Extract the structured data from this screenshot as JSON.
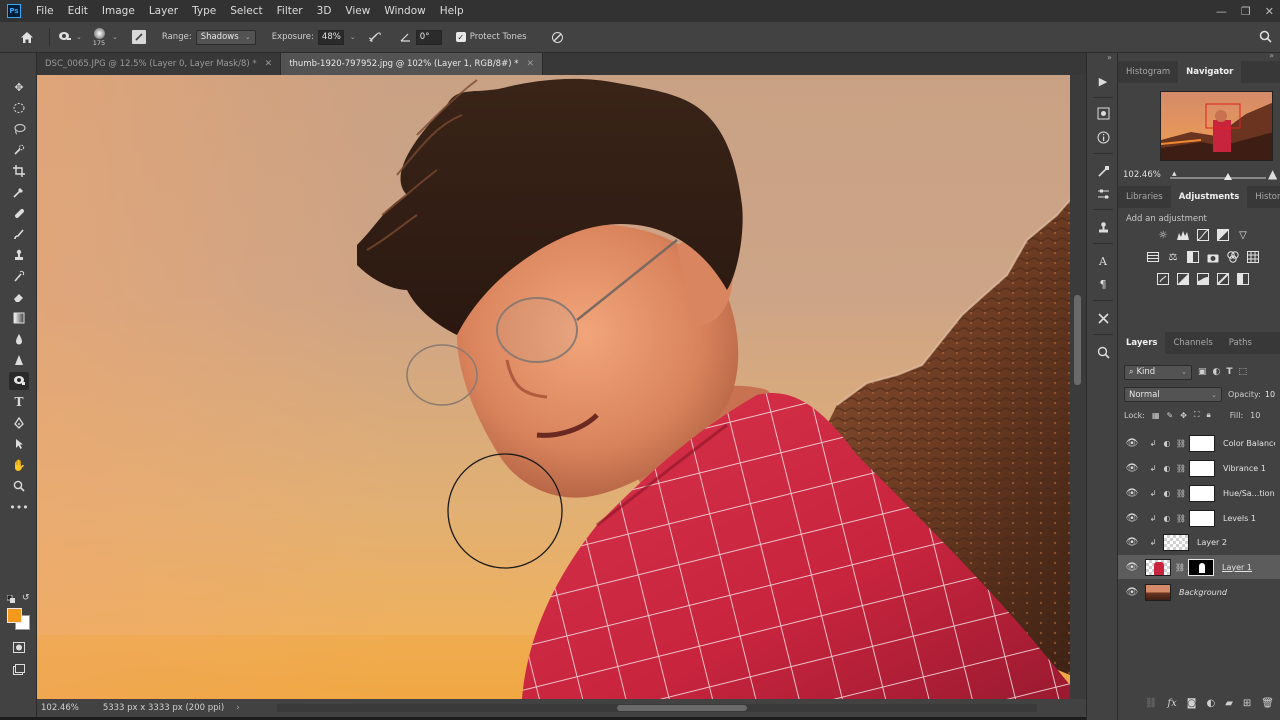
{
  "menu": [
    "File",
    "Edit",
    "Image",
    "Layer",
    "Type",
    "Select",
    "Filter",
    "3D",
    "View",
    "Window",
    "Help"
  ],
  "options": {
    "brush_size": "175",
    "range_label": "Range:",
    "range_value": "Shadows",
    "exposure_label": "Exposure:",
    "exposure_value": "48%",
    "angle_value": "0°",
    "protect_tones_label": "Protect Tones",
    "protect_tones_checked": true
  },
  "tabs": [
    {
      "title": "DSC_0065.JPG @ 12.5% (Layer 0, Layer Mask/8) *",
      "active": false
    },
    {
      "title": "thumb-1920-797952.jpg @ 102% (Layer 1, RGB/8#) *",
      "active": true
    }
  ],
  "status": {
    "zoom": "102.46%",
    "doc_info": "5333 px x 3333 px (200 ppi)"
  },
  "navigator": {
    "tabs": [
      "Histogram",
      "Navigator"
    ],
    "active_tab": "Navigator",
    "zoom": "102.46%",
    "zoom_fraction": 0.6
  },
  "adjustments": {
    "tabs": [
      "Libraries",
      "Adjustments",
      "History"
    ],
    "active_tab": "Adjustments",
    "title": "Add an adjustment"
  },
  "layers": {
    "tabs": [
      "Layers",
      "Channels",
      "Paths"
    ],
    "active_tab": "Layers",
    "kind_filter": "Kind",
    "blend_mode": "Normal",
    "opacity_label": "Opacity:",
    "opacity_value": "10",
    "lock_label": "Lock:",
    "fill_label": "Fill:",
    "fill_value": "10",
    "items": [
      {
        "name": "Color Balance",
        "type": "adjustment"
      },
      {
        "name": "Vibrance 1",
        "type": "adjustment"
      },
      {
        "name": "Hue/Sa...tion",
        "type": "adjustment"
      },
      {
        "name": "Levels 1",
        "type": "adjustment"
      },
      {
        "name": "Layer 2",
        "type": "pixel"
      },
      {
        "name": "Layer 1",
        "type": "masked",
        "selected": true
      },
      {
        "name": "Background",
        "type": "background"
      }
    ]
  },
  "colors": {
    "foreground": "#f39a1c",
    "background": "#ffffff",
    "accent": "#31a8ff"
  }
}
